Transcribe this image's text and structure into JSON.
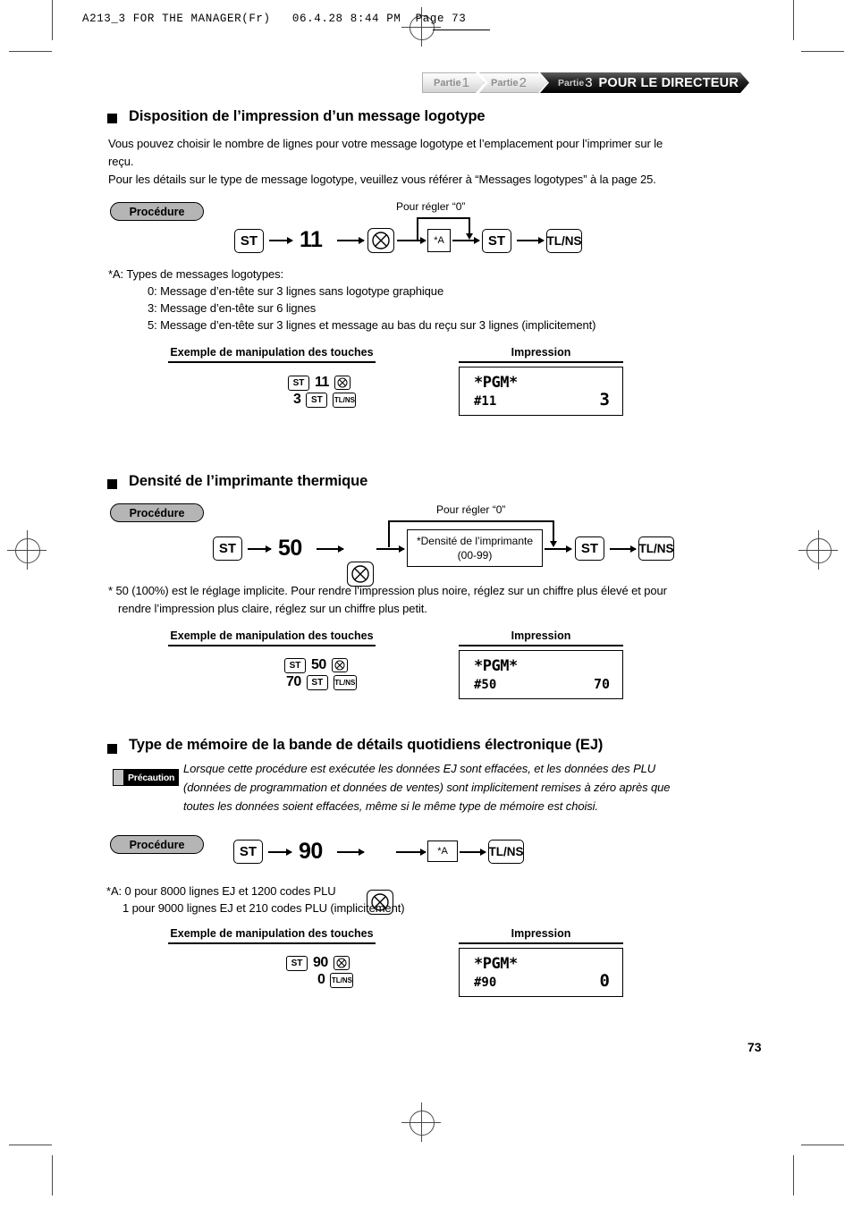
{
  "file_header": "A213_3 FOR THE MANAGER(Fr)   06.4.28 8:44 PM  Page 73",
  "banner": {
    "part1_label": "Partie",
    "part1_num": "1",
    "part2_label": "Partie",
    "part2_num": "2",
    "part3_label": "Partie",
    "part3_num": "3",
    "title": "POUR LE DIRECTEUR"
  },
  "labels": {
    "procedure": "Procédure",
    "example_header": "Exemple de manipulation des touches",
    "impression_header": "Impression",
    "set_zero": "Pour régler “0”",
    "caution": "Précaution",
    "key_st": "ST",
    "key_tlns": "TL/NS",
    "key_a": "*A"
  },
  "page_number": "73",
  "sections": [
    {
      "title": "Disposition de l’impression d’un message logotype",
      "body": [
        "Vous pouvez choisir le nombre de lignes pour votre message logotype et l’emplacement pour l’imprimer sur le",
        "reçu.",
        "Pour les détails sur le type de message logotype, veuillez vous référer à “Messages logotypes” à la page 25."
      ],
      "flow_number": "11",
      "notes": [
        "*A:   Types de messages logotypes:",
        "0:  Message d’en-tête sur 3 lignes sans logotype graphique",
        "3:  Message d’en-tête sur 6 lignes",
        "5:  Message d’en-tête sur 3 lignes et message au bas du reçu sur 3 lignes (implicitement)"
      ],
      "example_line1": [
        "ST",
        "11",
        "⊗"
      ],
      "example_line2": [
        "3",
        "ST",
        "TL/NS"
      ],
      "receipt": {
        "title": "*PGM*",
        "item": "#11",
        "value": "3"
      }
    },
    {
      "title": "Densité de l’imprimante thermique",
      "flow_number": "50",
      "box_line1": "*Densité de l’imprimante",
      "box_line2": "(00-99)",
      "footnote": [
        "* 50 (100%) est le réglage implicite. Pour rendre l’impression plus noire, réglez sur un chiffre plus élevé et pour",
        "rendre l’impression plus claire, réglez sur un chiffre plus petit."
      ],
      "example_line1": [
        "ST",
        "50",
        "⊗"
      ],
      "example_line2": [
        "70",
        "ST",
        "TL/NS"
      ],
      "receipt": {
        "title": "*PGM*",
        "item": "#50",
        "value": "70"
      }
    },
    {
      "title": "Type de mémoire de la bande de détails quotidiens électronique (EJ)",
      "caution_body": [
        "Lorsque cette procédure est exécutée les données EJ sont effacées, et les données des PLU",
        "(données de programmation et données de ventes) sont implicitement remises à zéro après que",
        "toutes les données soient effacées, même si le même type de mémoire est choisi."
      ],
      "flow_number": "90",
      "notes": [
        "*A: 0 pour 8000 lignes EJ et 1200 codes PLU",
        "1 pour 9000 lignes EJ et 210 codes PLU (implicitement)"
      ],
      "example_line1": [
        "ST",
        "90",
        "⊗"
      ],
      "example_line2": [
        "0",
        "TL/NS"
      ],
      "receipt": {
        "title": "*PGM*",
        "item": "#90",
        "value": "0"
      }
    }
  ]
}
